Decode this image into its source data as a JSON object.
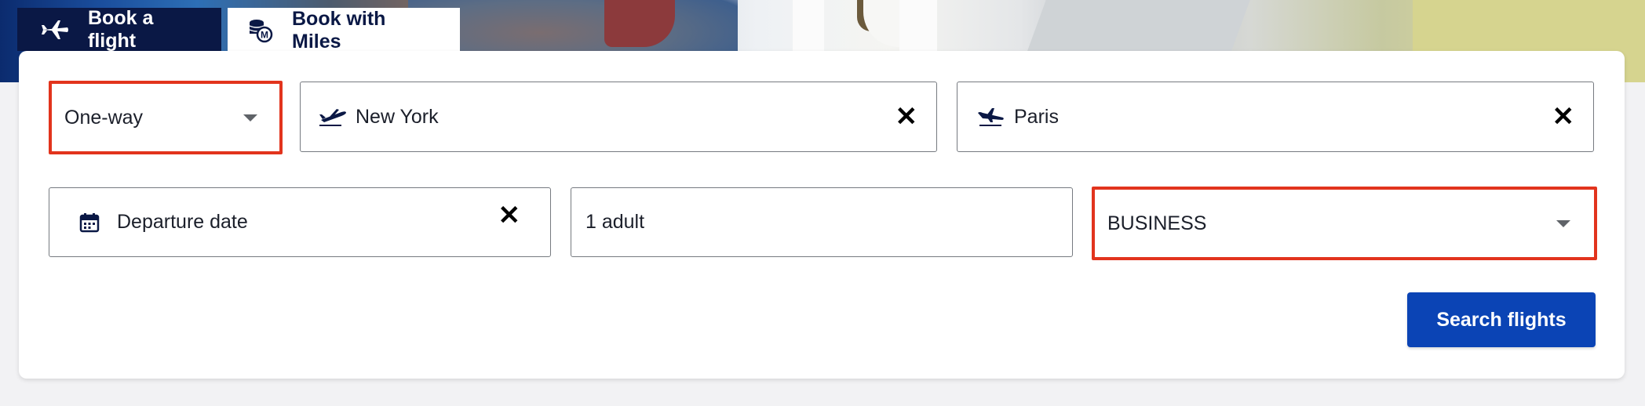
{
  "tabs": [
    {
      "label": "Book a flight",
      "icon": "airplane-icon"
    },
    {
      "label": "Book with Miles",
      "icon": "miles-coins-icon"
    }
  ],
  "form": {
    "trip_type": {
      "value": "One-way",
      "highlighted": true
    },
    "origin": {
      "value": "New York",
      "icon": "takeoff-plane-icon"
    },
    "destination": {
      "value": "Paris",
      "icon": "landing-plane-icon"
    },
    "departure": {
      "placeholder": "Departure date",
      "icon": "calendar-icon"
    },
    "passengers": {
      "value": "1 adult"
    },
    "cabin": {
      "value": "BUSINESS",
      "highlighted": true
    },
    "search_label": "Search flights"
  },
  "colors": {
    "navy": "#0a1845",
    "primary_button": "#0b44b5",
    "highlight": "#e2341d"
  }
}
